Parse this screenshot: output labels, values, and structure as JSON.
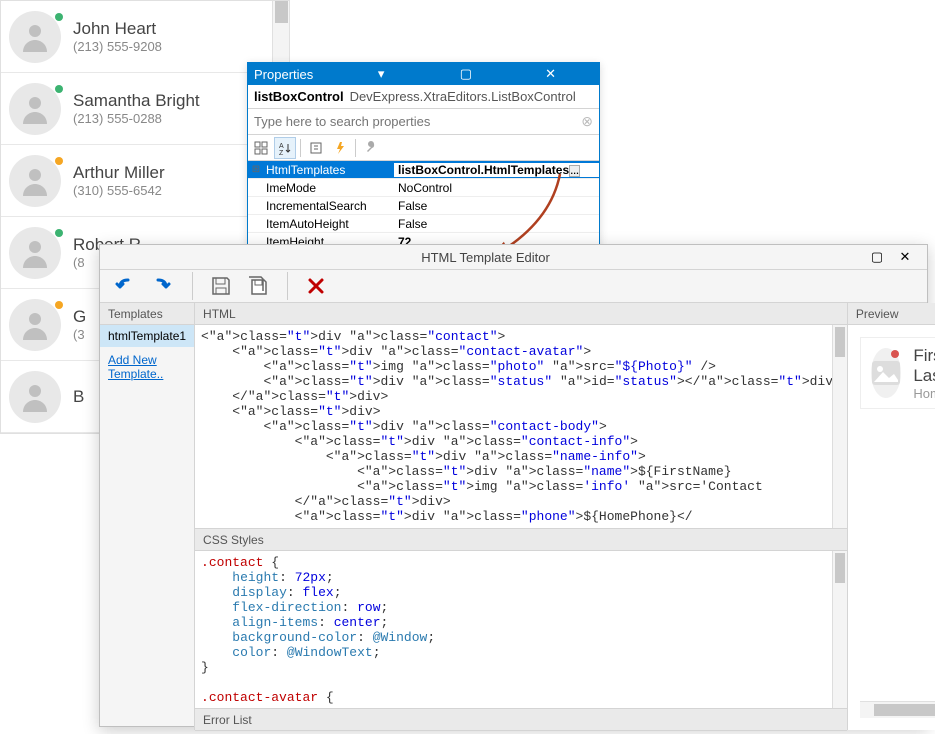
{
  "contacts": [
    {
      "name": "John Heart",
      "phone": "(213) 555-9208",
      "status": "#3cb371"
    },
    {
      "name": "Samantha Bright",
      "phone": "(213) 555-0288",
      "status": "#3cb371"
    },
    {
      "name": "Arthur Miller",
      "phone": "(310) 555-6542",
      "status": "#f5a623"
    },
    {
      "name": "Robert R",
      "phone": "(8",
      "status": "#3cb371"
    },
    {
      "name": "G",
      "phone": "(3",
      "status": "#f5a623"
    },
    {
      "name": "B",
      "phone": "",
      "status": ""
    }
  ],
  "properties": {
    "title": "Properties",
    "combo_name": "listBoxControl",
    "combo_type": "DevExpress.XtraEditors.ListBoxControl",
    "search_placeholder": "Type here to search properties",
    "rows": [
      {
        "name": "HtmlTemplates",
        "value": "listBoxControl.HtmlTemplates",
        "selected": true,
        "exp": "⊞",
        "btn": true
      },
      {
        "name": "ImeMode",
        "value": "NoControl"
      },
      {
        "name": "IncrementalSearch",
        "value": "False"
      },
      {
        "name": "ItemAutoHeight",
        "value": "False"
      },
      {
        "name": "ItemHeight",
        "value": "72",
        "bold": true
      }
    ]
  },
  "editor": {
    "title": "HTML Template Editor",
    "panels": {
      "templates": "Templates",
      "html": "HTML",
      "css": "CSS Styles",
      "preview": "Preview",
      "errors": "Error List"
    },
    "template_item": "htmlTemplate1",
    "add_template": "Add New Template..",
    "preview_name": "FirstName LastName",
    "preview_sub": "HomePhone",
    "html_lines": [
      "<div class=\"contact\">",
      "    <div class=\"contact-avatar\">",
      "        <img class=\"photo\" src=\"${Photo}\" />",
      "        <div class=\"status\" id=\"status\"></div>",
      "    </div>",
      "    <div>",
      "        <div class=\"contact-body\">",
      "            <div class=\"contact-info\">",
      "                <div class=\"name-info\">",
      "                    <div class=\"name\">${FirstName}",
      "                    <img class='info' src='Contact",
      "            </div>",
      "            <div class=\"phone\">${HomePhone}</"
    ],
    "css_lines": [
      ".contact {",
      "    height: 72px;",
      "    display: flex;",
      "    flex-direction: row;",
      "    align-items: center;",
      "    background-color: @Window;",
      "    color: @WindowText;",
      "}",
      "",
      ".contact-avatar {"
    ]
  }
}
